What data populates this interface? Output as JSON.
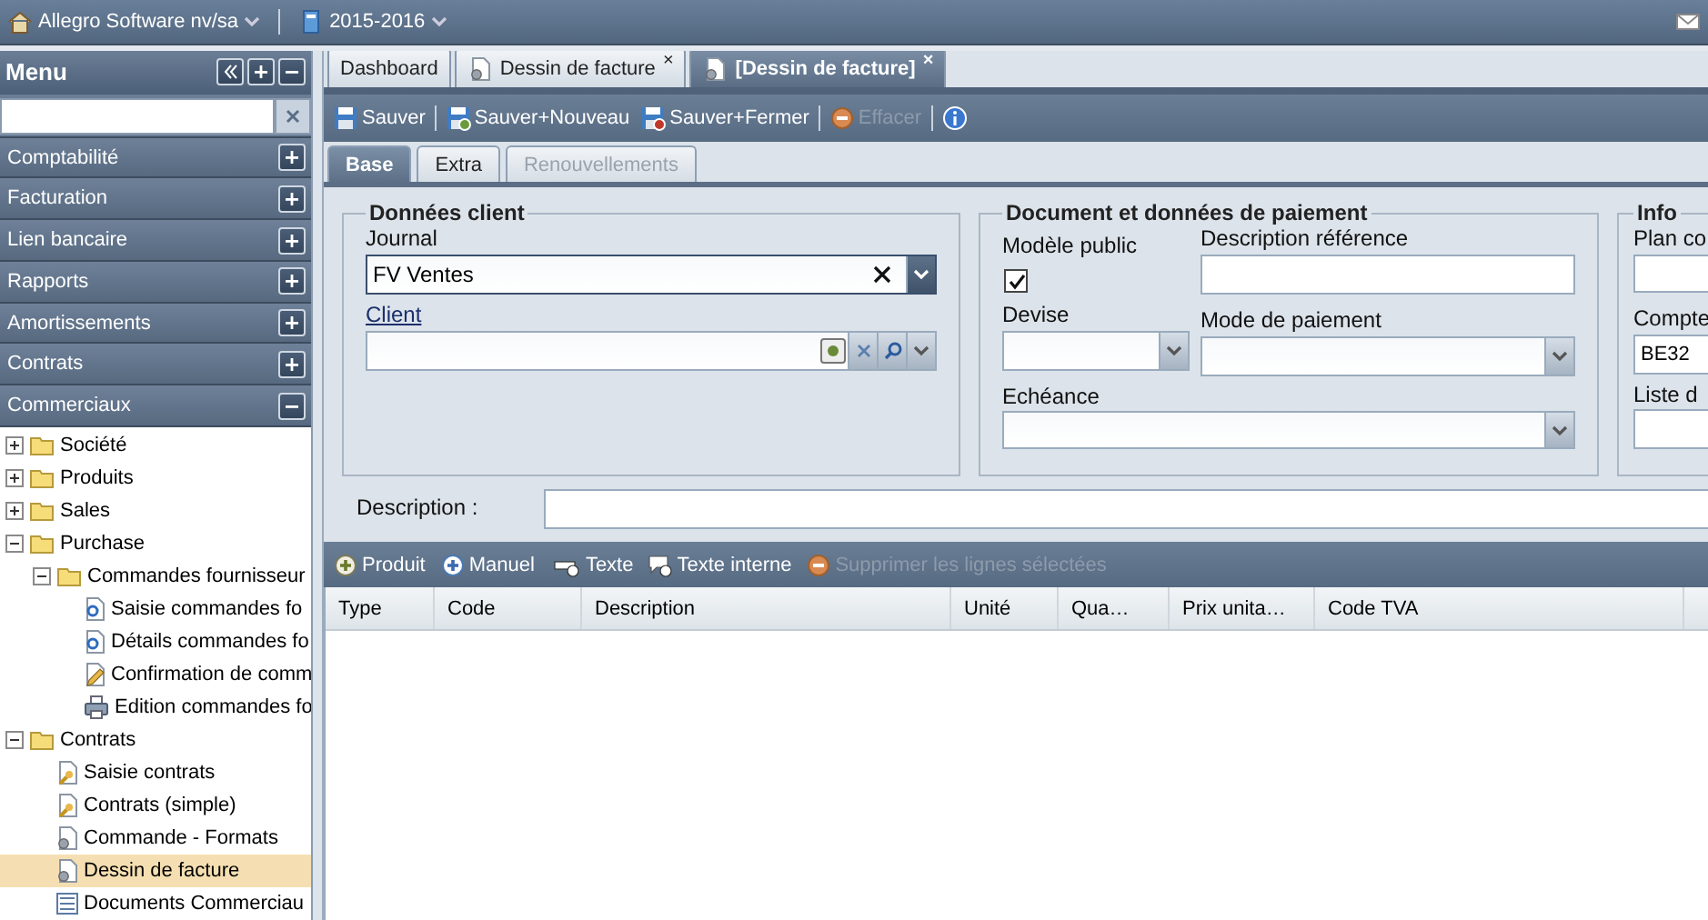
{
  "topbar": {
    "company": "Allegro Software nv/sa",
    "year": "2015-2016"
  },
  "menu": {
    "title": "Menu",
    "sections": [
      {
        "label": "Comptabilité",
        "expanded": false
      },
      {
        "label": "Facturation",
        "expanded": false
      },
      {
        "label": "Lien bancaire",
        "expanded": false
      },
      {
        "label": "Rapports",
        "expanded": false
      },
      {
        "label": "Amortissements",
        "expanded": false
      },
      {
        "label": "Contrats",
        "expanded": false
      },
      {
        "label": "Commerciaux",
        "expanded": true
      }
    ],
    "tree": [
      {
        "label": "Société",
        "kind": "folder",
        "expanded": false,
        "selected": false
      },
      {
        "label": "Produits",
        "kind": "folder",
        "expanded": false,
        "selected": false
      },
      {
        "label": "Sales",
        "kind": "folder",
        "expanded": false,
        "selected": false
      },
      {
        "label": "Purchase",
        "kind": "folder",
        "expanded": true,
        "selected": false,
        "children": [
          {
            "label": "Commandes fournisseur",
            "kind": "folder",
            "expanded": true,
            "selected": false,
            "children": [
              {
                "label": "Saisie commandes fo",
                "kind": "cdoc",
                "selected": false
              },
              {
                "label": "Détails commandes fo",
                "kind": "cdoc",
                "selected": false
              },
              {
                "label": "Confirmation de comm",
                "kind": "pencil",
                "selected": false
              },
              {
                "label": "Edition commandes fo",
                "kind": "printer",
                "selected": false
              }
            ]
          }
        ]
      },
      {
        "label": "Contrats",
        "kind": "folder",
        "expanded": true,
        "selected": false,
        "children": [
          {
            "label": "Saisie contrats",
            "kind": "keydoc",
            "selected": false
          },
          {
            "label": "Contrats (simple)",
            "kind": "keydoc",
            "selected": false
          },
          {
            "label": "Commande - Formats",
            "kind": "geardoc",
            "selected": false
          },
          {
            "label": "Dessin de facture",
            "kind": "geardoc",
            "selected": true
          },
          {
            "label": "Documents Commerciau",
            "kind": "listdoc",
            "selected": false
          }
        ]
      }
    ]
  },
  "tabs": [
    {
      "label": "Dashboard",
      "kind": "plain",
      "selected": false
    },
    {
      "label": "Dessin de facture",
      "kind": "doc",
      "selected": false,
      "close": "×"
    },
    {
      "label": "[Dessin de facture]",
      "kind": "doc",
      "selected": true,
      "close": "×"
    }
  ],
  "toolbar": [
    {
      "label": "Sauver",
      "kind": "save",
      "disabled": false
    },
    {
      "label": "Sauver+Nouveau",
      "kind": "savenew",
      "disabled": false
    },
    {
      "label": "Sauver+Fermer",
      "kind": "saveclose",
      "disabled": false
    },
    {
      "label": "Effacer",
      "kind": "delete",
      "disabled": true
    },
    {
      "kind": "info"
    }
  ],
  "subtabs": [
    {
      "label": "Base",
      "selected": true,
      "disabled": false
    },
    {
      "label": "Extra",
      "selected": false,
      "disabled": false
    },
    {
      "label": "Renouvellements",
      "selected": false,
      "disabled": true
    }
  ],
  "client": {
    "title": "Données client",
    "journal_label": "Journal",
    "journal_value": "FV Ventes",
    "client_label": "Client"
  },
  "document": {
    "title": "Document et données de paiement",
    "public_label": "Modèle public",
    "public_checked": true,
    "ref_label": "Description référence",
    "currency_label": "Devise",
    "payment_label": "Mode de paiement",
    "due_label": "Echéance"
  },
  "info": {
    "title": "Info",
    "plan_label": "Plan co",
    "account_label": "Compte",
    "account_value": "BE32",
    "list_label": "Liste d"
  },
  "description_label": "Description :",
  "lines_toolbar": [
    {
      "label": "Produit",
      "kind": "plus",
      "disabled": false
    },
    {
      "label": "Manuel",
      "kind": "plusblue",
      "disabled": false
    },
    {
      "label": "Texte",
      "kind": "text",
      "disabled": false
    },
    {
      "label": "Texte interne",
      "kind": "note",
      "disabled": false
    },
    {
      "label": "Supprimer les lignes sélectées",
      "kind": "delete",
      "disabled": true
    }
  ],
  "columns": [
    {
      "label": "Type"
    },
    {
      "label": "Code"
    },
    {
      "label": "Description"
    },
    {
      "label": "Unité"
    },
    {
      "label": "Qua…"
    },
    {
      "label": "Prix unita…"
    },
    {
      "label": "Code TVA"
    }
  ]
}
